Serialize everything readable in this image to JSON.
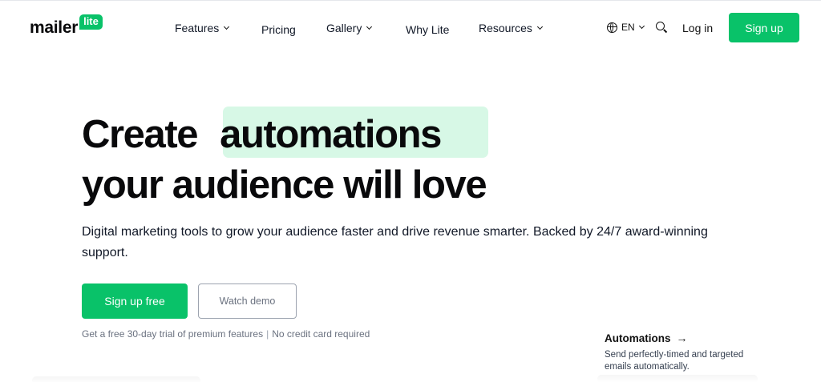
{
  "brand": {
    "logo_word": "mailer",
    "logo_badge": "lite",
    "accent_color": "#09c269",
    "highlight_color": "#d7f8e6"
  },
  "nav": {
    "features": "Features",
    "pricing": "Pricing",
    "gallery": "Gallery",
    "why_lite": "Why Lite",
    "resources": "Resources"
  },
  "header_actions": {
    "language": "EN",
    "language_icon": "globe-icon",
    "search_icon": "search-icon",
    "login": "Log in",
    "signup": "Sign up"
  },
  "hero": {
    "headline_word1": "Create",
    "headline_highlight": "automations",
    "headline_line2": "your audience will love",
    "subtitle": "Digital marketing tools to grow your audience faster and drive revenue smarter. Backed by 24/7 award-winning support.",
    "primary_cta": "Sign up free",
    "secondary_cta": "Watch demo",
    "fineprint_left": "Get a free 30-day trial of premium features",
    "fineprint_sep": "|",
    "fineprint_right": "No credit card required"
  },
  "feature_card": {
    "title": "Automations",
    "arrow": "→",
    "description": "Send perfectly-timed and targeted emails automatically."
  }
}
